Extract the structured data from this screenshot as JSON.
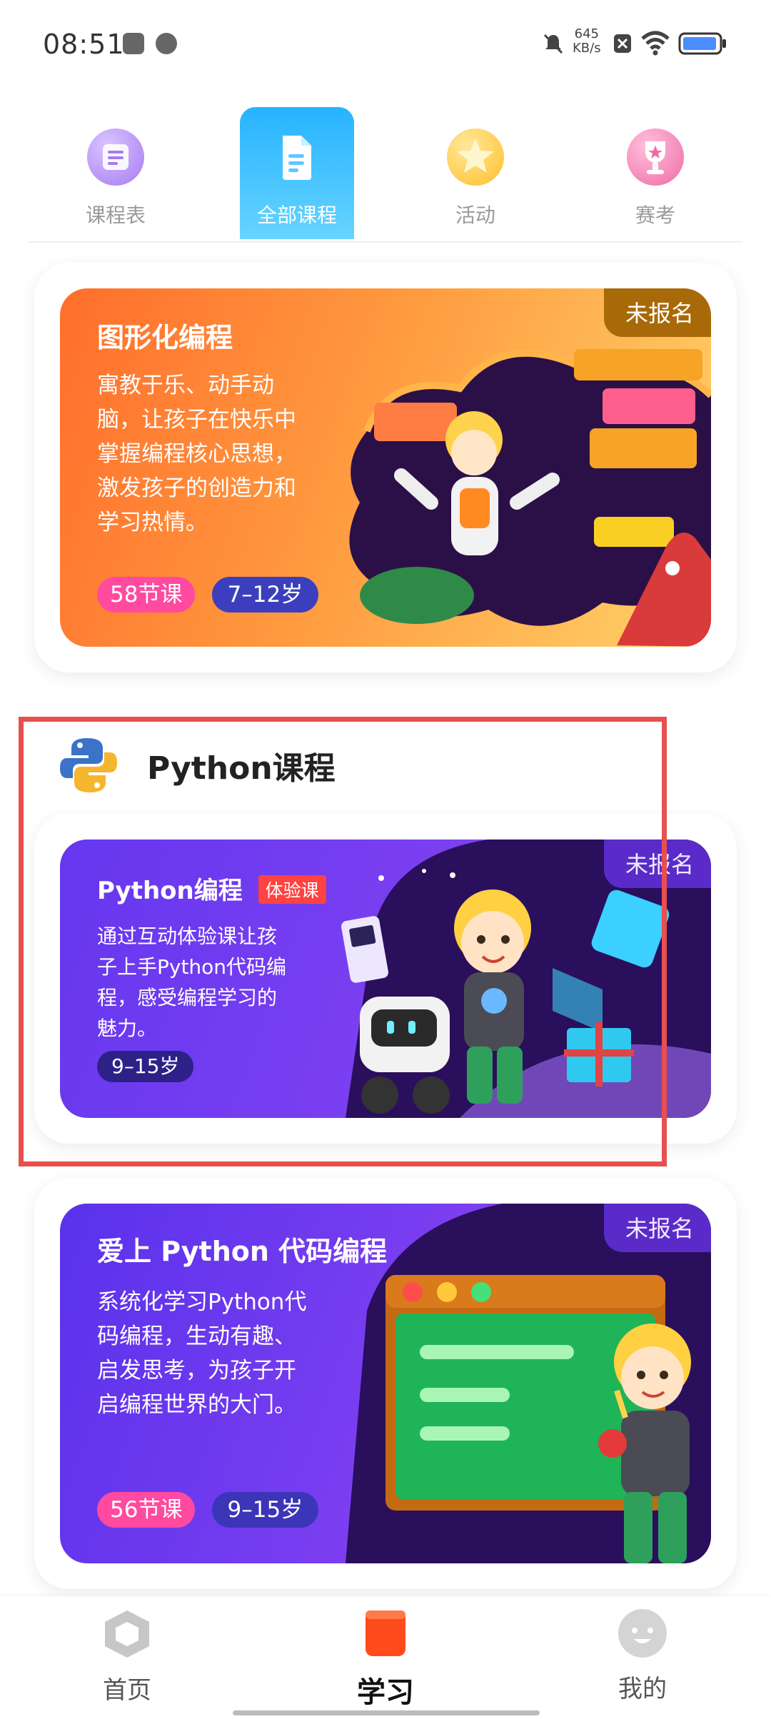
{
  "status_bar": {
    "time": "08:51",
    "net_speed_value": "645",
    "net_speed_unit": "KB/s",
    "icons": [
      "save-icon",
      "upload-icon",
      "mute-icon",
      "sim-off-icon",
      "wifi-icon",
      "battery-icon"
    ]
  },
  "top_tabs": {
    "items": [
      {
        "label": "课程表",
        "icon": "schedule-icon",
        "color": "#b98ef5"
      },
      {
        "label": "全部课程",
        "icon": "document-icon",
        "color": "#ffffff"
      },
      {
        "label": "活动",
        "icon": "star-icon",
        "color": "#ffce3d"
      },
      {
        "label": "赛考",
        "icon": "trophy-icon",
        "color": "#f47bb0"
      }
    ],
    "active_index": 1
  },
  "courses": [
    {
      "title": "图形化编程",
      "status": "未报名",
      "description_lines": [
        "寓教于乐、动手动",
        "脑，让孩子在快乐中",
        "掌握编程核心思想，",
        "激发孩子的创造力和",
        "学习热情。"
      ],
      "lessons": "58节课",
      "age": "7–12岁",
      "colors": {
        "from": "#ff7a2e",
        "to": "#ffc056"
      }
    }
  ],
  "python_section": {
    "title": "Python课程",
    "icon": "python-logo-icon",
    "courses": [
      {
        "title": "Python编程",
        "badge": "体验课",
        "status": "未报名",
        "description_lines": [
          "通过互动体验课让孩",
          "子上手Python代码编",
          "程，感受编程学习的",
          "魅力。"
        ],
        "age": "9–15岁",
        "colors": {
          "from": "#6b3ff0",
          "to": "#9b4bf0"
        }
      },
      {
        "title": "爱上 Python 代码编程",
        "status": "未报名",
        "description_lines": [
          "系统化学习Python代",
          "码编程，生动有趣、",
          "启发思考，为孩子开",
          "启编程世界的大门。"
        ],
        "lessons": "56节课",
        "age": "9–15岁",
        "colors": {
          "from": "#5e37ee",
          "to": "#9b4bf0"
        }
      }
    ]
  },
  "bottom_nav": {
    "items": [
      {
        "label": "首页",
        "icon": "hexagon-home-icon"
      },
      {
        "label": "学习",
        "icon": "book-icon"
      },
      {
        "label": "我的",
        "icon": "smiley-avatar-icon"
      }
    ],
    "active_index": 1
  }
}
